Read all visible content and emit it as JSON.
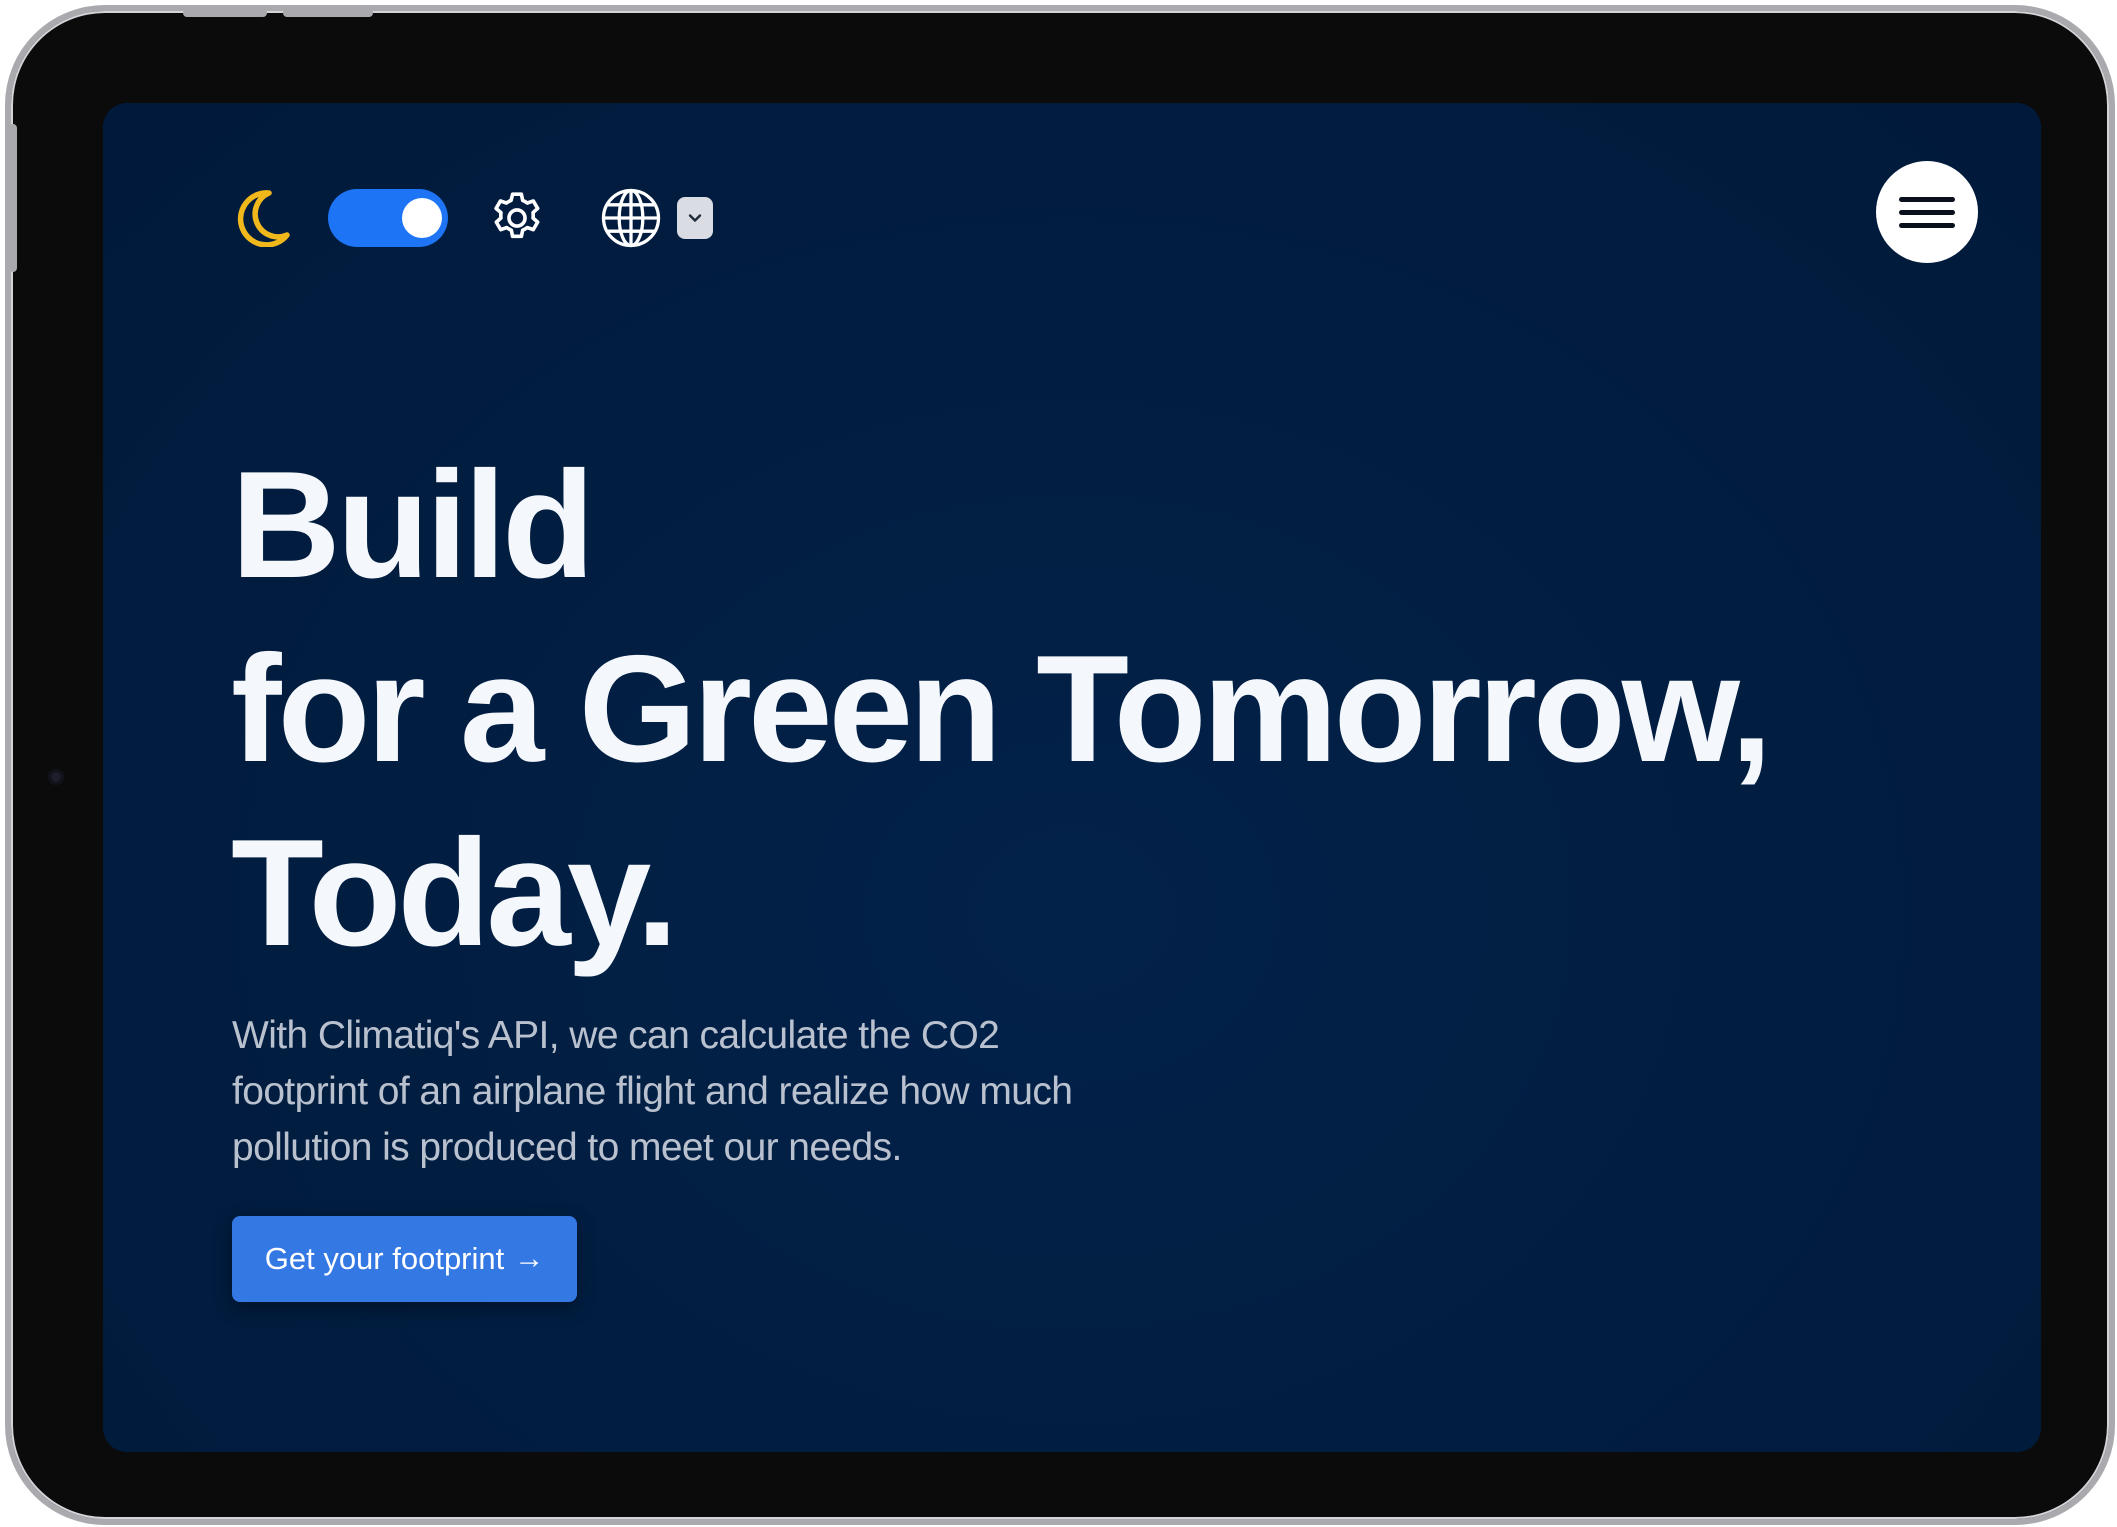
{
  "toolbar": {
    "theme_icon": "moon-icon",
    "theme_toggle_on": true,
    "settings_icon": "gear-icon",
    "language_icon": "globe-icon",
    "language_dropdown_icon": "chevron-down-icon",
    "menu_icon": "hamburger-menu-icon"
  },
  "hero": {
    "title_lines": [
      "Build",
      "for a Green Tomorrow,",
      "Today."
    ],
    "description": "With Climatiq's API, we can calculate the CO2 footprint of an airplane flight and realize how much pollution is produced to meet our needs.",
    "cta_label": "Get your footprint",
    "cta_arrow": "→"
  },
  "colors": {
    "background": "#011d40",
    "accent": "#1d74f5",
    "button": "#3478e4",
    "moon": "#f1b81c",
    "title": "#f4f7fb",
    "description": "#b9c1cf"
  }
}
